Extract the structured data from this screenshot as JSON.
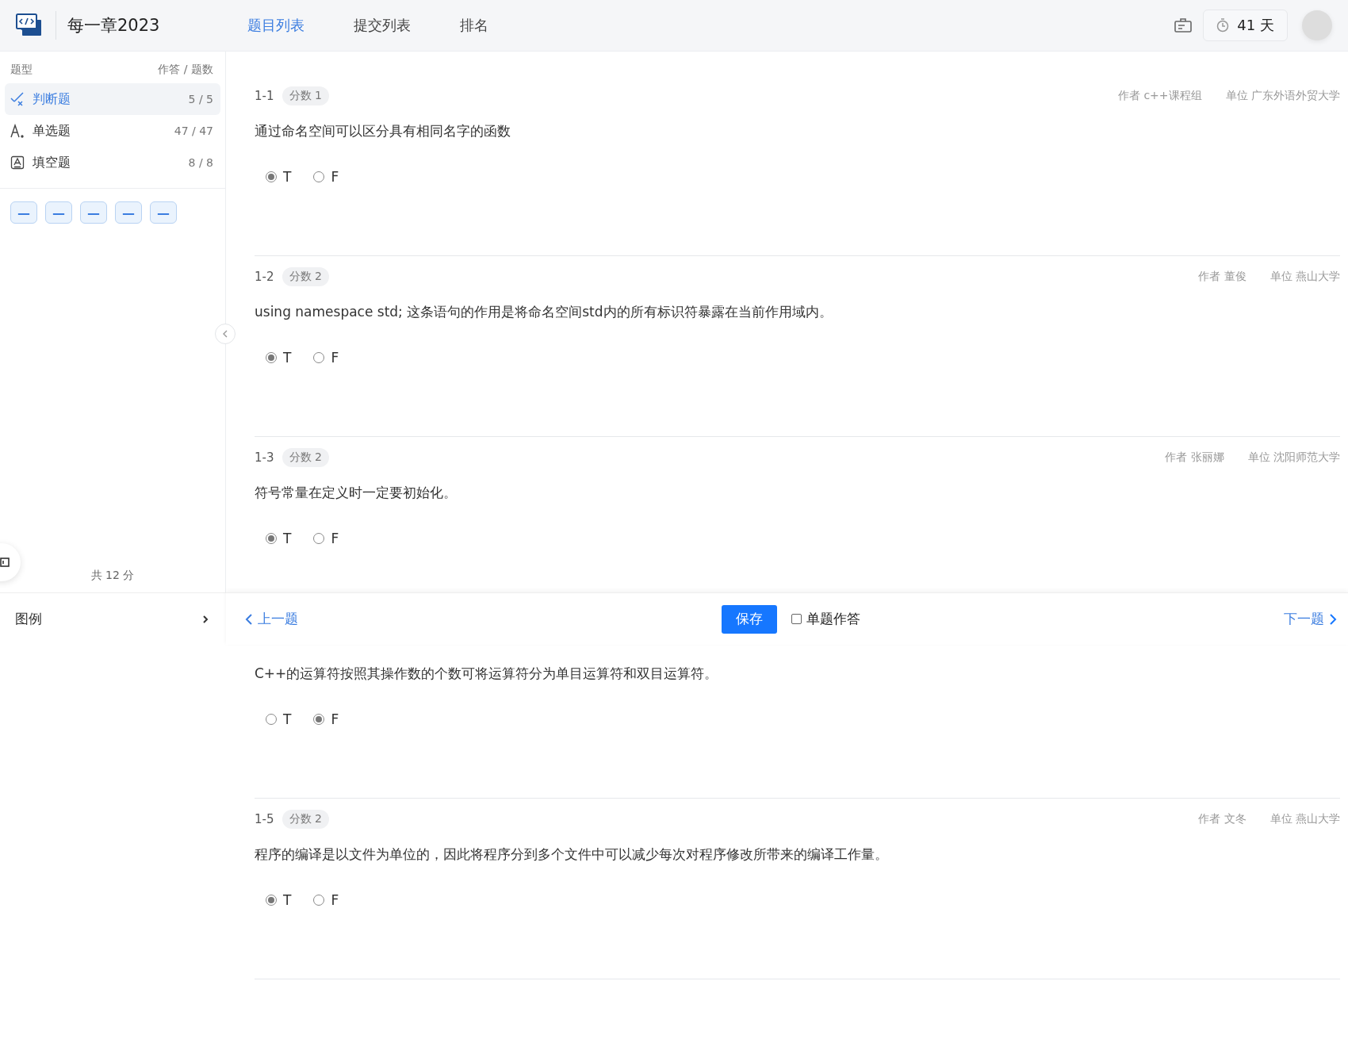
{
  "header": {
    "title": "每一章2023",
    "tabs": [
      {
        "label": "题目列表",
        "selected": true
      },
      {
        "label": "提交列表",
        "selected": false
      },
      {
        "label": "排名",
        "selected": false
      }
    ],
    "timer": "41 天"
  },
  "sidebar": {
    "head_left": "题型",
    "head_right": "作答 / 题数",
    "types": [
      {
        "kind": "judge",
        "label": "判断题",
        "count": "5 / 5",
        "selected": true
      },
      {
        "kind": "choice",
        "label": "单选题",
        "count": "47 / 47",
        "selected": false
      },
      {
        "kind": "blank",
        "label": "填空题",
        "count": "8 / 8",
        "selected": false
      }
    ],
    "question_buttons": [
      {
        "label": "—"
      },
      {
        "label": "—"
      },
      {
        "label": "—"
      },
      {
        "label": "—"
      },
      {
        "label": "—"
      }
    ],
    "total": "共 12 分",
    "legend": "图例"
  },
  "questions": [
    {
      "number": "1-1",
      "score": "分数 1",
      "author": "作者 c++课程组",
      "unit": "单位 广东外语外贸大学",
      "text": "通过命名空间可以区分具有相同名字的函数",
      "options": [
        {
          "label": "T",
          "selected": true
        },
        {
          "label": "F",
          "selected": false
        }
      ]
    },
    {
      "number": "1-2",
      "score": "分数 2",
      "author": "作者 董俊",
      "unit": "单位 燕山大学",
      "text": "using namespace std; 这条语句的作用是将命名空间std内的所有标识符暴露在当前作用域内。",
      "options": [
        {
          "label": "T",
          "selected": true
        },
        {
          "label": "F",
          "selected": false
        }
      ]
    },
    {
      "number": "1-3",
      "score": "分数 2",
      "author": "作者 张丽娜",
      "unit": "单位 沈阳师范大学",
      "text": "符号常量在定义时一定要初始化。",
      "options": [
        {
          "label": "T",
          "selected": true
        },
        {
          "label": "F",
          "selected": false
        }
      ]
    },
    {
      "text": "C++的运算符按照其操作数的个数可将运算符分为单目运算符和双目运算符。",
      "options": [
        {
          "label": "T",
          "selected": false
        },
        {
          "label": "F",
          "selected": true
        }
      ]
    },
    {
      "number": "1-5",
      "score": "分数 2",
      "author": "作者 文冬",
      "unit": "单位 燕山大学",
      "text": "程序的编译是以文件为单位的，因此将程序分到多个文件中可以减少每次对程序修改所带来的编译工作量。",
      "options": [
        {
          "label": "T",
          "selected": true
        },
        {
          "label": "F",
          "selected": false
        }
      ]
    }
  ],
  "footer": {
    "prev": "上一题",
    "save": "保存",
    "single": {
      "label": "单题作答",
      "checked": false
    },
    "next": "下一题"
  }
}
